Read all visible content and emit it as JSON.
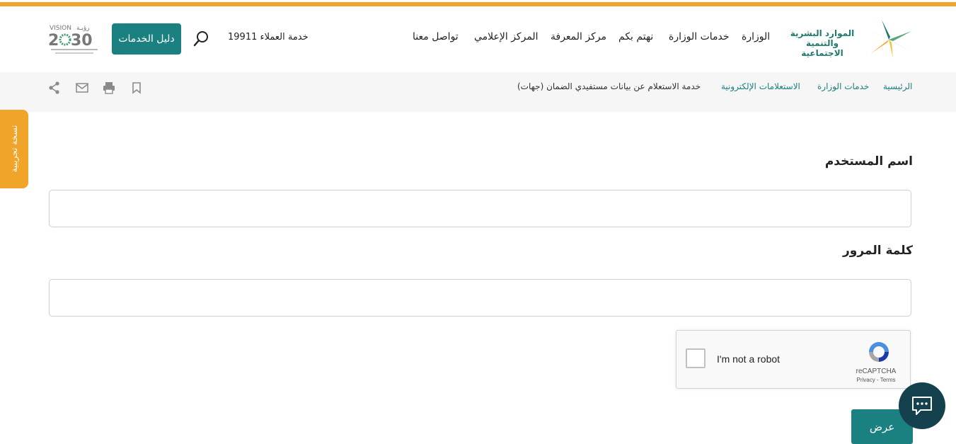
{
  "brand": {
    "ministry_line1": "الموارد البشرية",
    "ministry_line2": "والتنمية الاجتماعية",
    "accent_color": "#1b8080",
    "orange_color": "#f0a52a"
  },
  "nav": {
    "items": [
      "الوزارة",
      "خدمات الوزارة",
      "نهتم بكم",
      "مركز المعرفة",
      "المركز الإعلامي",
      "تواصل معنا"
    ]
  },
  "header": {
    "customer_service": "خدمة العملاء 19911",
    "guide_button": "دليل الخدمات",
    "search_icon": "search-icon"
  },
  "breadcrumb": {
    "items": [
      "الرئيسية",
      "خدمات الوزارة",
      "الاستعلامات الإلكترونية",
      "خدمة الاستعلام عن بيانات مستفيدي الضمان (جهات)"
    ]
  },
  "tools": [
    "bookmark-icon",
    "print-icon",
    "mail-icon",
    "share-icon"
  ],
  "side_tab": {
    "label": "نسخة تجريبية"
  },
  "form": {
    "username_label": "اسم المستخدم",
    "username_value": "",
    "password_label": "كلمة المرور",
    "password_value": "",
    "submit_label": "عرض"
  },
  "captcha": {
    "checkbox_label": "I'm not a robot",
    "brand": "reCAPTCHA",
    "terms": "Privacy - Terms"
  },
  "chat": {
    "icon": "chat-icon"
  }
}
